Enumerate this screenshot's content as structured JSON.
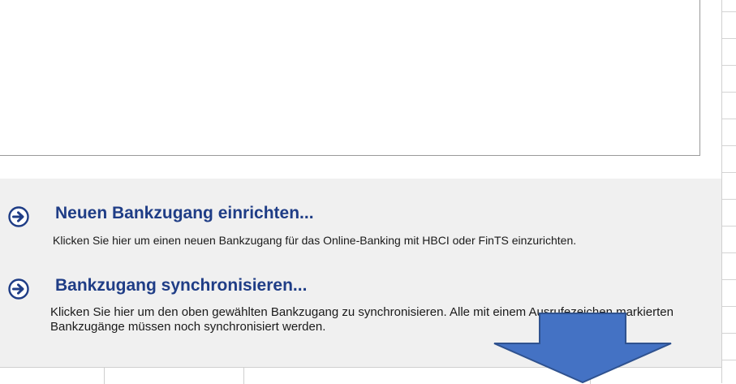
{
  "actions": [
    {
      "title": "Neuen Bankzugang einrichten...",
      "description": "Klicken Sie hier um einen neuen Bankzugang für das Online-Banking mit HBCI oder FinTS einzurichten.",
      "icon": "arrow-circle-right-icon"
    },
    {
      "title": "Bankzugang synchronisieren...",
      "description": "Klicken Sie hier um den oben gewählten Bankzugang zu synchronisieren. Alle mit einem Ausrufezeichen markierten Bankzugänge müssen noch synchronisiert werden.",
      "icon": "arrow-circle-right-icon"
    }
  ],
  "colors": {
    "title": "#1f3d86",
    "icon": "#1f3d86",
    "panel": "#f0f0f0",
    "overlay_arrow": "#4472c4"
  },
  "overlay": {
    "icon": "arrow-down-annotation-icon"
  }
}
